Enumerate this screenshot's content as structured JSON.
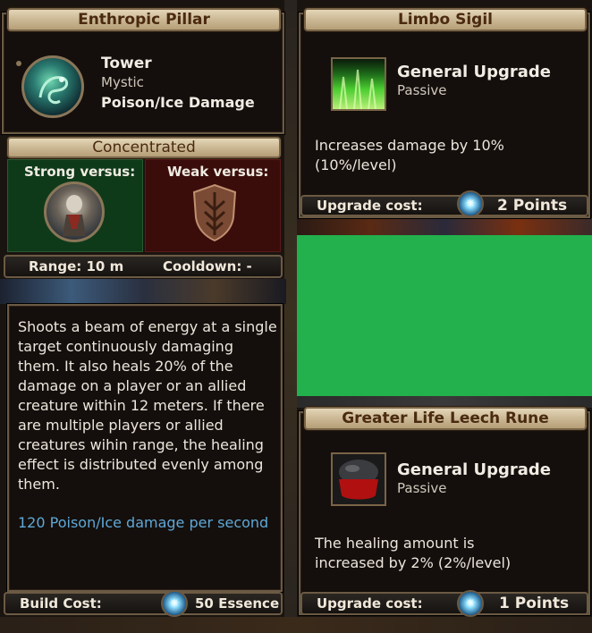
{
  "left_panel": {
    "title": "Enthropic Pillar",
    "type": "Tower",
    "subtype": "Mystic",
    "damage_type": "Poison/Ice Damage",
    "stance": "Concentrated",
    "strong_label": "Strong versus:",
    "weak_label": "Weak versus:",
    "range": "Range: 10 m",
    "cooldown": "Cooldown: -",
    "description": "Shoots a beam of energy at a single target continuously damaging them. It also heals 20% of the damage on a player or an allied creature within 12 meters. If there are multiple players or allied creatures wihin range, the healing effect is distributed evenly among them.",
    "damage_stat": "120 Poison/Ice damage per second",
    "build_cost_label": "Build Cost:",
    "build_cost_value": "50 Essence"
  },
  "upgrade_top": {
    "title": "Limbo Sigil",
    "category": "General Upgrade",
    "kind": "Passive",
    "description": "Increases damage by 10% (10%/level)",
    "cost_label": "Upgrade cost:",
    "cost_value": "2 Points"
  },
  "upgrade_bottom": {
    "title": "Greater Life Leech Rune",
    "category": "General Upgrade",
    "kind": "Passive",
    "description": "The healing amount is increased by 2% (2%/level)",
    "cost_label": "Upgrade cost:",
    "cost_value": "1 Points"
  },
  "colors": {
    "stat_blue": "#5fa8d8",
    "strong_bg": "#123a1c",
    "weak_bg": "#3a0e0c",
    "placeholder_green": "#22b14c"
  },
  "icons": {
    "tower": "serpent-icon",
    "strong": "armored-warrior-icon",
    "weak": "shield-icon",
    "sigil": "green-flame-icon",
    "rune": "blood-rune-icon",
    "cost": "essence-crystal-icon"
  }
}
